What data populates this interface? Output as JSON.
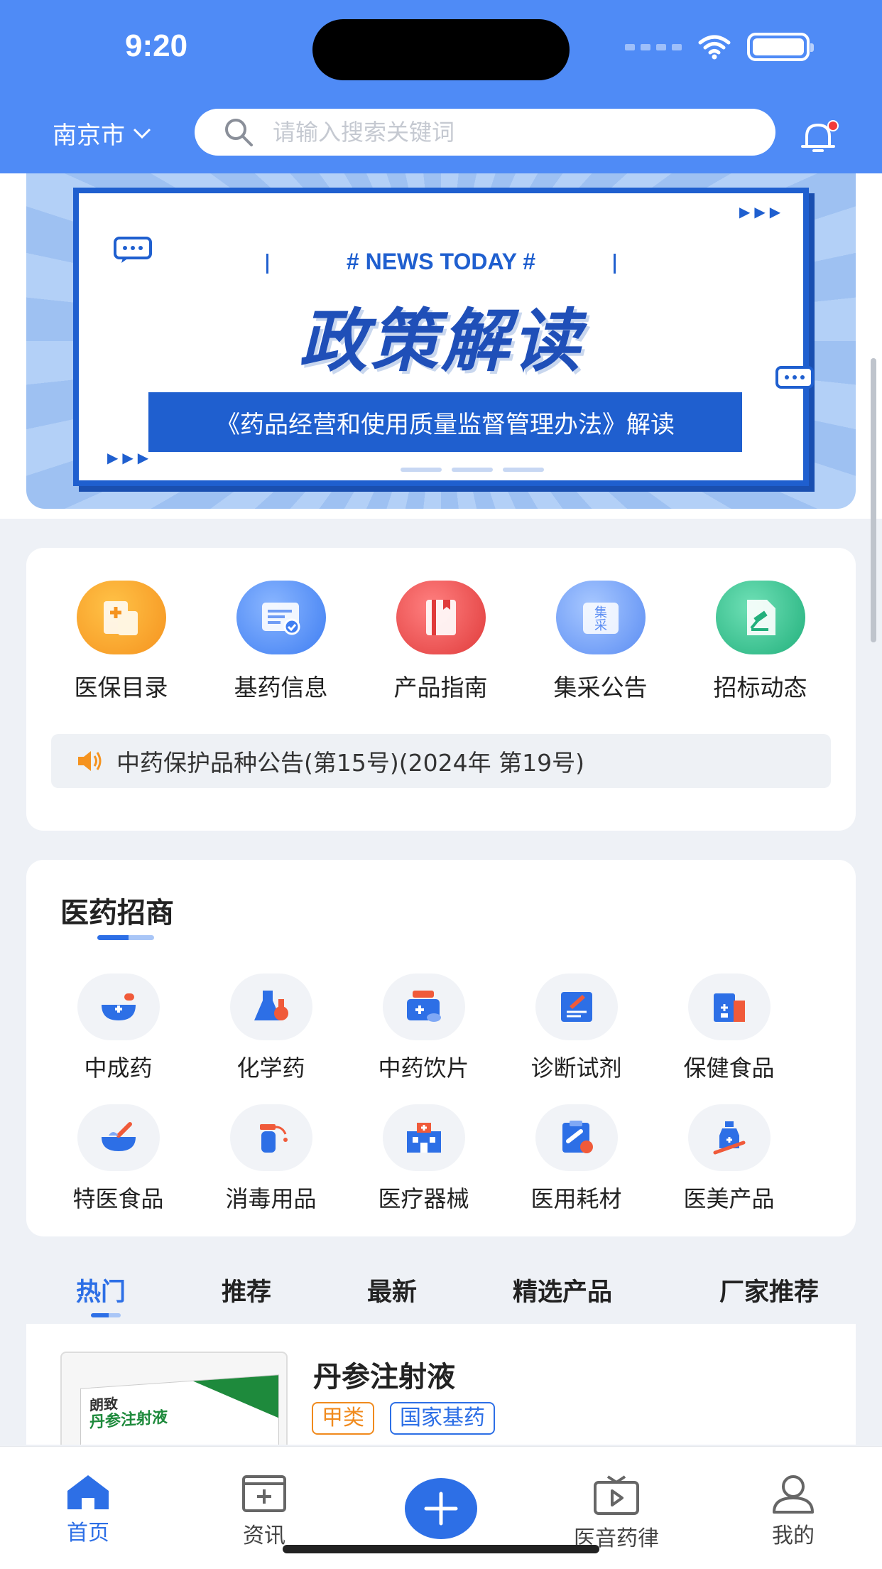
{
  "status_bar": {
    "time": "9:20"
  },
  "header": {
    "city": "南京市",
    "search_placeholder": "请输入搜索关键词"
  },
  "banner": {
    "tag": "# NEWS TODAY #",
    "title": "政策解读",
    "subtitle": "《药品经营和使用质量监督管理办法》解读"
  },
  "shortcuts": [
    {
      "label": "医保目录",
      "icon": "medical-insurance-icon",
      "color": "#f59a23"
    },
    {
      "label": "基药信息",
      "icon": "document-check-icon",
      "color": "#4f8bf6"
    },
    {
      "label": "产品指南",
      "icon": "book-icon",
      "color": "#ef4d4d"
    },
    {
      "label": "集采公告",
      "icon": "procurement-icon",
      "color": "#6d9cf8"
    },
    {
      "label": "招标动态",
      "icon": "gavel-icon",
      "color": "#2ec28e"
    }
  ],
  "notice": {
    "text": "中药保护品种公告(第15号)(2024年 第19号)"
  },
  "pharma": {
    "title": "医药招商",
    "categories": [
      {
        "label": "中成药",
        "icon": "mortar-icon"
      },
      {
        "label": "化学药",
        "icon": "flask-icon"
      },
      {
        "label": "中药饮片",
        "icon": "medicine-box-icon"
      },
      {
        "label": "诊断试剂",
        "icon": "diagnosis-icon"
      },
      {
        "label": "保健食品",
        "icon": "health-food-icon"
      },
      {
        "label": "特医食品",
        "icon": "bowl-icon"
      },
      {
        "label": "消毒用品",
        "icon": "spray-icon"
      },
      {
        "label": "医疗器械",
        "icon": "hospital-icon"
      },
      {
        "label": "医用耗材",
        "icon": "clipboard-icon"
      },
      {
        "label": "医美产品",
        "icon": "beauty-icon"
      }
    ]
  },
  "tabs": [
    "热门",
    "推荐",
    "最新",
    "精选产品",
    "厂家推荐"
  ],
  "product": {
    "name": "丹参注射液",
    "tags": [
      "甲类",
      "国家基药"
    ],
    "box_text": "丹参注射液",
    "box_brand": "朗致"
  },
  "bottom_nav": {
    "home": "首页",
    "news": "资讯",
    "audio": "医音药律",
    "mine": "我的"
  },
  "colors": {
    "primary": "#2d6fe6",
    "header": "#4f8bf6",
    "tag_orange": "#f08a1d"
  }
}
